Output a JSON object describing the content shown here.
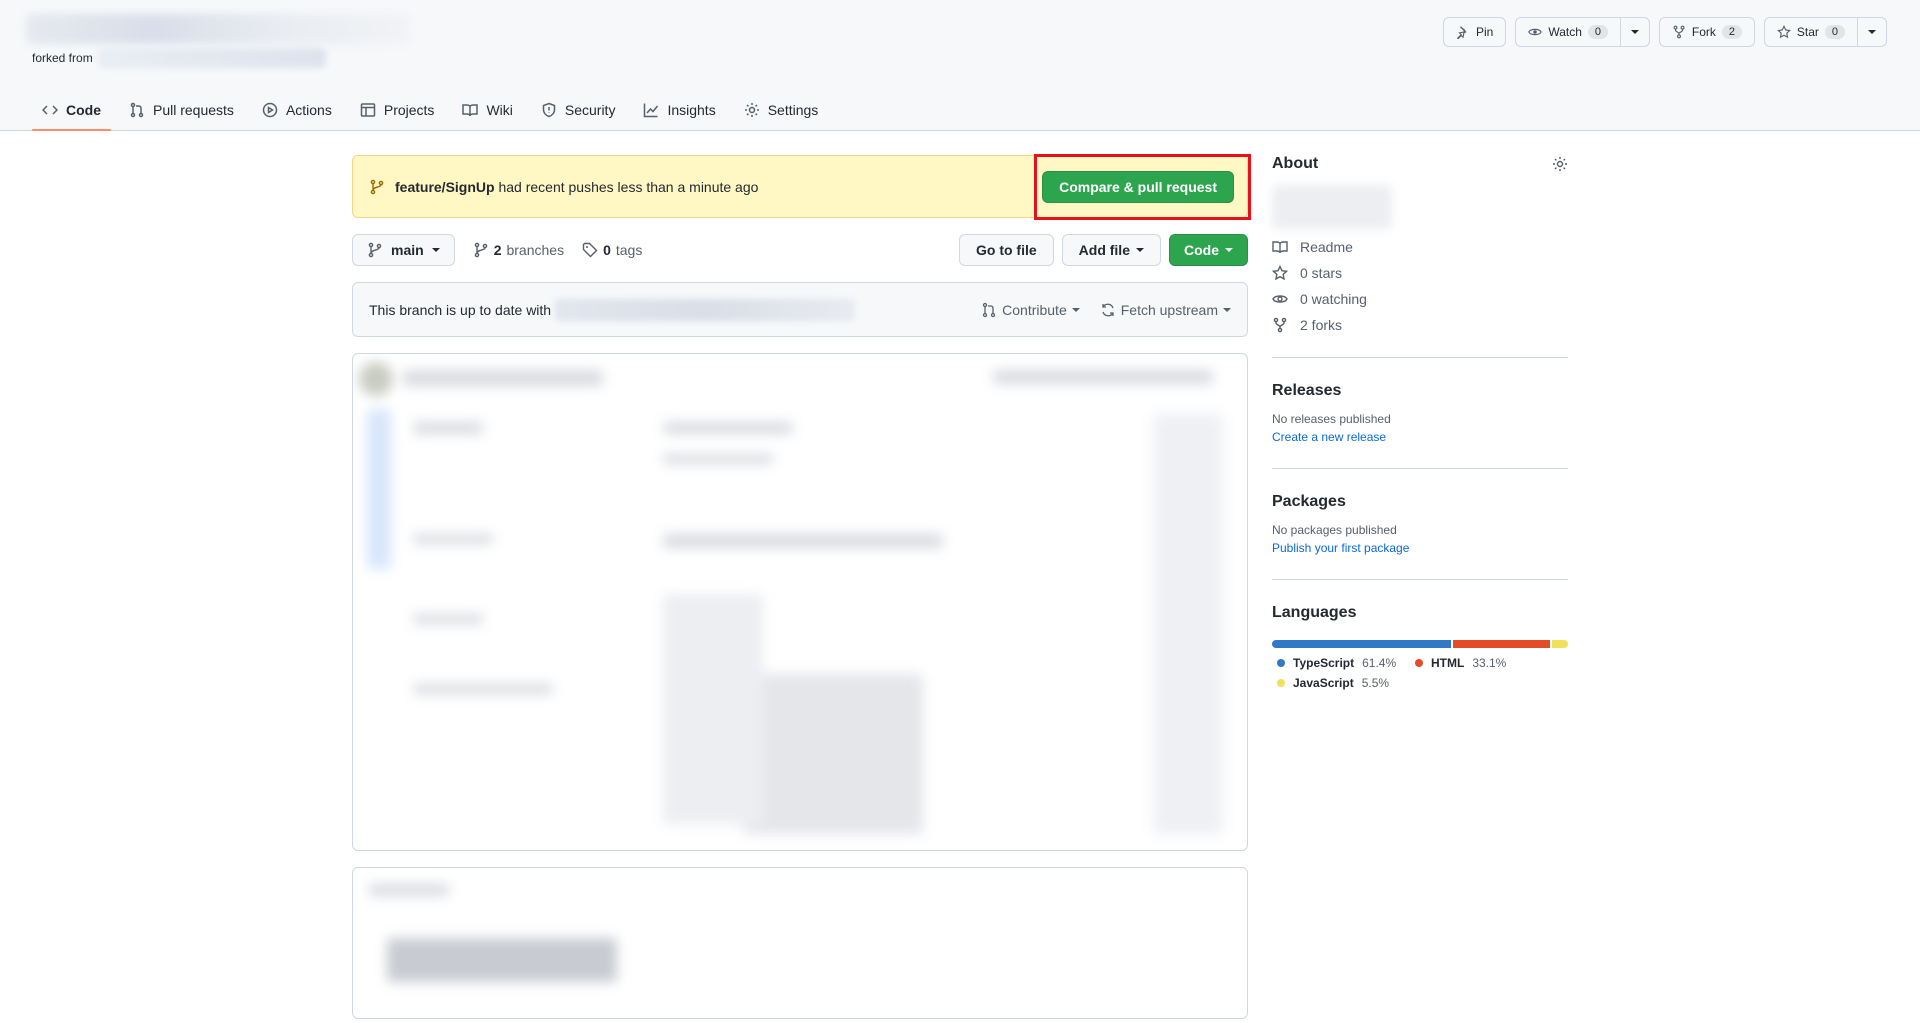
{
  "header": {
    "forked_from_label": "forked from",
    "pin_label": "Pin",
    "watch_label": "Watch",
    "watch_count": "0",
    "fork_label": "Fork",
    "fork_count": "2",
    "star_label": "Star",
    "star_count": "0"
  },
  "tabs": [
    {
      "label": "Code",
      "icon": "code-icon"
    },
    {
      "label": "Pull requests",
      "icon": "pull-request-icon"
    },
    {
      "label": "Actions",
      "icon": "play-icon"
    },
    {
      "label": "Projects",
      "icon": "table-icon"
    },
    {
      "label": "Wiki",
      "icon": "book-icon"
    },
    {
      "label": "Security",
      "icon": "shield-icon"
    },
    {
      "label": "Insights",
      "icon": "graph-icon"
    },
    {
      "label": "Settings",
      "icon": "gear-icon"
    }
  ],
  "flash": {
    "branch": "feature/SignUp",
    "message": "had recent pushes less than a minute ago",
    "button": "Compare & pull request"
  },
  "toolbar": {
    "branch": "main",
    "branches_count": "2",
    "branches_label": "branches",
    "tags_count": "0",
    "tags_label": "tags",
    "go_to_file": "Go to file",
    "add_file": "Add file",
    "code": "Code"
  },
  "status": {
    "text": "This branch is up to date with",
    "contribute": "Contribute",
    "fetch": "Fetch upstream"
  },
  "sidebar": {
    "about_title": "About",
    "readme": "Readme",
    "stars": "0 stars",
    "watching": "0 watching",
    "forks": "2 forks",
    "releases_title": "Releases",
    "releases_empty": "No releases published",
    "releases_link": "Create a new release",
    "packages_title": "Packages",
    "packages_empty": "No packages published",
    "packages_link": "Publish your first package",
    "languages_title": "Languages",
    "languages": [
      {
        "name": "TypeScript",
        "percent": "61.4%",
        "value": 61.4,
        "color": "#3178c6"
      },
      {
        "name": "HTML",
        "percent": "33.1%",
        "value": 33.1,
        "color": "#e34c26"
      },
      {
        "name": "JavaScript",
        "percent": "5.5%",
        "value": 5.5,
        "color": "#f1e05a"
      }
    ]
  }
}
